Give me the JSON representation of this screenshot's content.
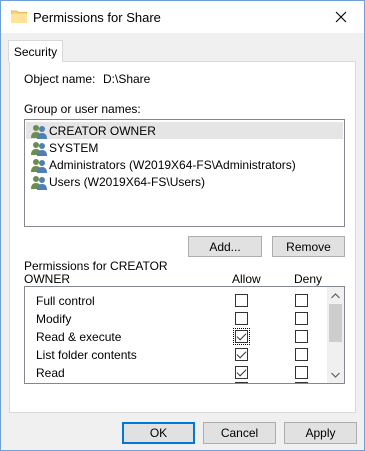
{
  "window": {
    "title": "Permissions for Share"
  },
  "tabs": [
    {
      "label": "Security"
    }
  ],
  "object": {
    "label": "Object name:",
    "value": "D:\\Share"
  },
  "groups": {
    "label": "Group or user names:",
    "items": [
      {
        "label": "CREATOR OWNER",
        "selected": true
      },
      {
        "label": "SYSTEM"
      },
      {
        "label": "Administrators (W2019X64-FS\\Administrators)"
      },
      {
        "label": "Users (W2019X64-FS\\Users)"
      }
    ]
  },
  "buttons": {
    "add": "Add...",
    "remove": "Remove",
    "ok": "OK",
    "cancel": "Cancel",
    "apply": "Apply"
  },
  "permissions": {
    "label_line1": "Permissions for CREATOR",
    "label_line2": "OWNER",
    "allow_header": "Allow",
    "deny_header": "Deny",
    "rows": [
      {
        "name": "Full control",
        "allow": false,
        "deny": false
      },
      {
        "name": "Modify",
        "allow": false,
        "deny": false
      },
      {
        "name": "Read & execute",
        "allow": true,
        "deny": false
      },
      {
        "name": "List folder contents",
        "allow": true,
        "deny": false
      },
      {
        "name": "Read",
        "allow": true,
        "deny": false
      }
    ]
  },
  "icons": {
    "folder": "folder-icon",
    "close": "close-icon",
    "user": "user-group-icon"
  }
}
